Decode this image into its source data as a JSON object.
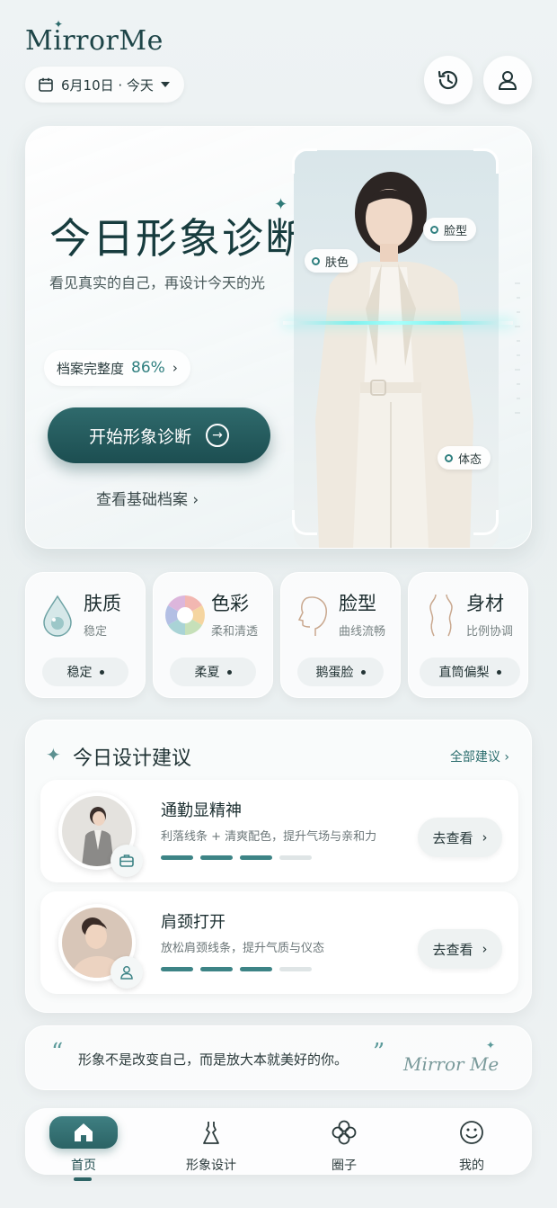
{
  "brand": "MirrorMe",
  "date_label": "6月10日 · 今天",
  "header_icons": [
    "history-icon",
    "profile-icon"
  ],
  "hero": {
    "title": "今日形象诊断",
    "subtitle": "看见真实的自己，再设计今天的光",
    "profile_label": "档案完整度",
    "profile_percent": "86%",
    "profile_value": 0.86,
    "cta_label": "开始形象诊断",
    "basic_link": "查看基础档案",
    "tags": {
      "face": "脸型",
      "skin": "肤色",
      "posture": "体态"
    }
  },
  "metrics": [
    {
      "title": "肤质",
      "sub": "稳定",
      "value": "稳定",
      "icon": "water-drop-icon"
    },
    {
      "title": "色彩",
      "sub": "柔和清透",
      "value": "柔夏",
      "icon": "color-wheel-icon"
    },
    {
      "title": "脸型",
      "sub": "曲线流畅",
      "value": "鹅蛋脸",
      "icon": "face-outline-icon"
    },
    {
      "title": "身材",
      "sub": "比例协调",
      "value": "直筒偏梨",
      "icon": "body-outline-icon"
    }
  ],
  "suggestions": {
    "title": "今日设计建议",
    "all_label": "全部建议",
    "items": [
      {
        "title": "通勤显精神",
        "desc": "利落线条 + 清爽配色，提升气场与亲和力",
        "button": "去查看",
        "progress": [
          1,
          1,
          1,
          0
        ]
      },
      {
        "title": "肩颈打开",
        "desc": "放松肩颈线条，提升气质与仪态",
        "button": "去查看",
        "progress": [
          1,
          1,
          1,
          0
        ]
      }
    ]
  },
  "quote": {
    "text": "形象不是改变自己，而是放大本就美好的你。",
    "signature": "Mirror Me"
  },
  "nav": [
    {
      "label": "首页",
      "icon": "home-icon",
      "active": true
    },
    {
      "label": "形象设计",
      "icon": "dress-icon",
      "active": false
    },
    {
      "label": "圈子",
      "icon": "clover-icon",
      "active": false
    },
    {
      "label": "我的",
      "icon": "smile-icon",
      "active": false
    }
  ],
  "colors": {
    "accent": "#2b6365",
    "accent_light": "#3d8486",
    "scan": "#7ef1ee"
  }
}
